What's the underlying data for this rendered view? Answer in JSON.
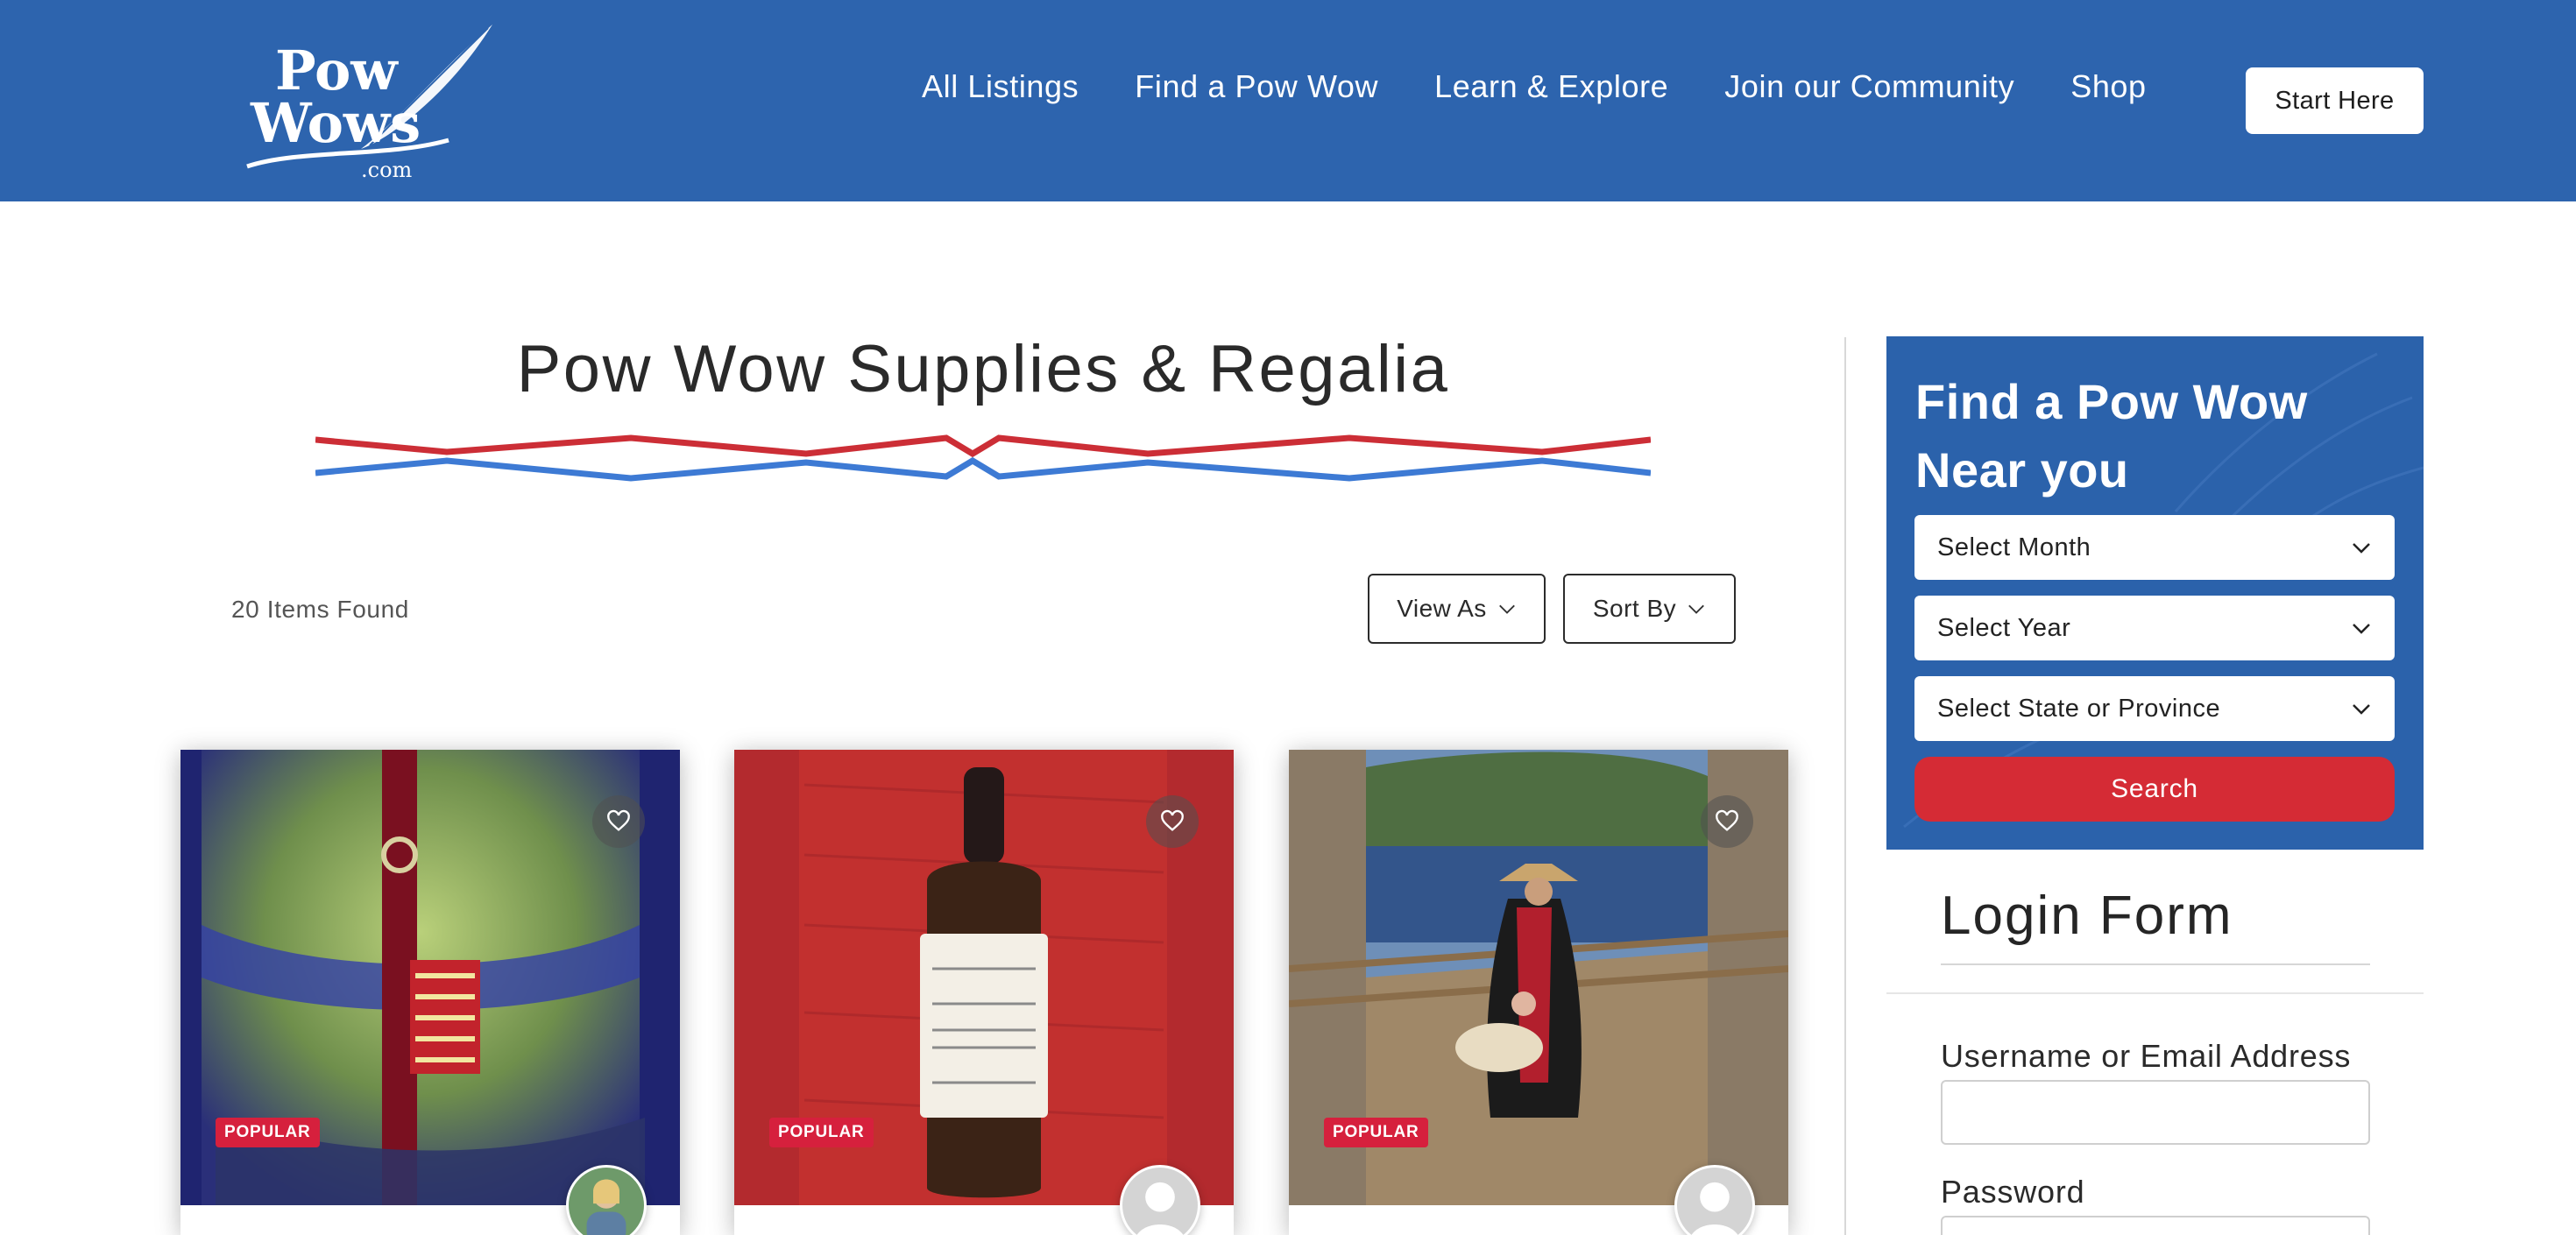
{
  "header": {
    "logo_text": "Pow Wows .com",
    "nav": [
      "All Listings",
      "Find a Pow Wow",
      "Learn & Explore",
      "Join our Community",
      "Shop"
    ],
    "cta": "Start Here",
    "bg_color": "#2d64ae"
  },
  "main": {
    "title": "Pow Wow Supplies & Regalia",
    "items_found": "20 Items Found",
    "view_as": "View As",
    "sort_by": "Sort By"
  },
  "cards": [
    {
      "badge": "POPULAR",
      "image": "beaded regalia photo",
      "favorite_icon": "heart-icon"
    },
    {
      "badge": "POPULAR",
      "image": "dropper bottle photo",
      "favorite_icon": "heart-icon"
    },
    {
      "badge": "POPULAR",
      "image": "dancers on boardwalk photo",
      "favorite_icon": "heart-icon"
    }
  ],
  "finder": {
    "title": "Find a Pow Wow Near you",
    "month": "Select Month",
    "year": "Select Year",
    "state": "Select State or Province",
    "search": "Search",
    "accent_color": "#d52b35"
  },
  "login": {
    "title": "Login Form",
    "username_label": "Username or Email Address",
    "password_label": "Password"
  }
}
